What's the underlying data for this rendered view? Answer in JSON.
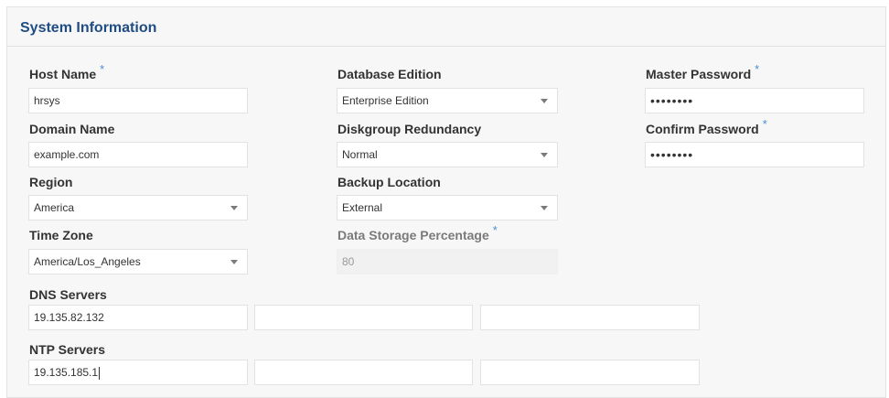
{
  "section": {
    "title": "System Information"
  },
  "fields": {
    "host_name": {
      "label": "Host Name",
      "value": "hrsys"
    },
    "domain_name": {
      "label": "Domain Name",
      "value": "example.com"
    },
    "region": {
      "label": "Region",
      "value": "America"
    },
    "time_zone": {
      "label": "Time Zone",
      "value": "America/Los_Angeles"
    },
    "database_edition": {
      "label": "Database Edition",
      "value": "Enterprise Edition"
    },
    "diskgroup_redundancy": {
      "label": "Diskgroup Redundancy",
      "value": "Normal"
    },
    "backup_location": {
      "label": "Backup Location",
      "value": "External"
    },
    "data_storage_percentage": {
      "label": "Data Storage Percentage",
      "value": "80"
    },
    "master_password": {
      "label": "Master Password",
      "value": "••••••••"
    },
    "confirm_password": {
      "label": "Confirm Password",
      "value": "••••••••"
    },
    "dns_servers": {
      "label": "DNS Servers",
      "values": [
        "19.135.82.132",
        "",
        ""
      ]
    },
    "ntp_servers": {
      "label": "NTP Servers",
      "values": [
        "19.135.185.1",
        "",
        ""
      ]
    }
  },
  "required_marker": "*",
  "icons": {
    "dropdown": "chevron-down-icon"
  },
  "colors": {
    "title": "#1f4d83",
    "required": "#4a8fd4",
    "panel_bg": "#f7f7f7"
  }
}
